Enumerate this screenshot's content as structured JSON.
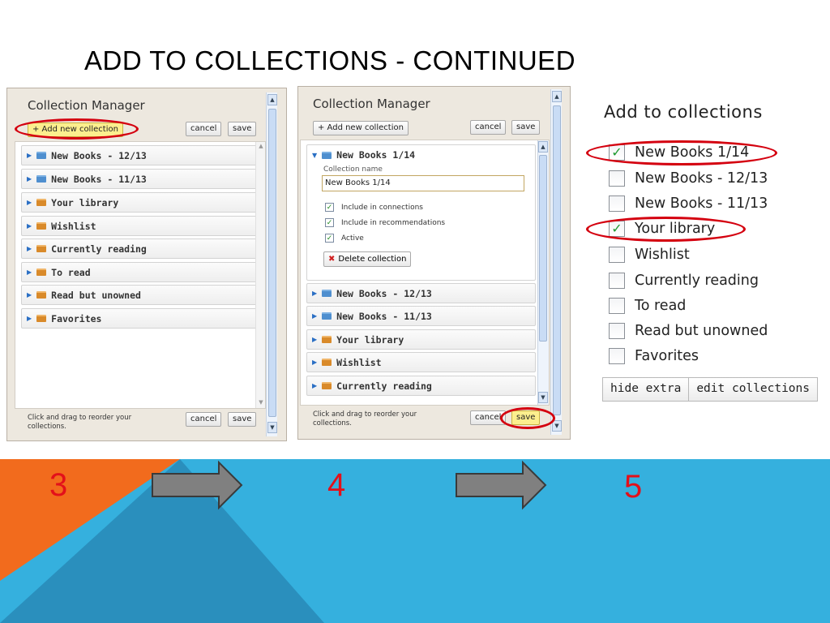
{
  "slide": {
    "title": "ADD TO COLLECTIONS - CONTINUED"
  },
  "panel3": {
    "title": "Collection Manager",
    "add_button": "+ Add new collection",
    "cancel": "cancel",
    "save": "save",
    "items": [
      {
        "label": "New Books - 12/13",
        "color": "blue"
      },
      {
        "label": "New Books - 11/13",
        "color": "blue"
      },
      {
        "label": "Your library",
        "color": "orange"
      },
      {
        "label": "Wishlist",
        "color": "orange"
      },
      {
        "label": "Currently reading",
        "color": "orange"
      },
      {
        "label": "To read",
        "color": "orange"
      },
      {
        "label": "Read but unowned",
        "color": "orange"
      },
      {
        "label": "Favorites",
        "color": "orange"
      }
    ],
    "footer_line1": "Click and drag to reorder your",
    "footer_line2": "collections.",
    "footer_cancel": "cancel",
    "footer_save": "save"
  },
  "panel4": {
    "title": "Collection Manager",
    "add_button": "+ Add new collection",
    "cancel": "cancel",
    "save": "save",
    "expanded": {
      "label": "New Books 1/14",
      "field_label": "Collection name",
      "field_value": "New Books 1/14",
      "options": [
        {
          "label": "Include in connections",
          "checked": true
        },
        {
          "label": "Include in recommendations",
          "checked": true
        },
        {
          "label": "Active",
          "checked": true
        }
      ],
      "delete_button": "Delete collection"
    },
    "items": [
      {
        "label": "New Books - 12/13",
        "color": "blue"
      },
      {
        "label": "New Books - 11/13",
        "color": "blue"
      },
      {
        "label": "Your library",
        "color": "orange"
      },
      {
        "label": "Wishlist",
        "color": "orange"
      },
      {
        "label": "Currently reading",
        "color": "orange"
      }
    ],
    "footer_line1": "Click and drag to reorder your",
    "footer_line2": "collections.",
    "footer_cancel": "cancel",
    "footer_save": "save"
  },
  "add_to_collections": {
    "title": "Add to collections",
    "items": [
      {
        "label": "New Books 1/14",
        "checked": true
      },
      {
        "label": "New Books - 12/13",
        "checked": false
      },
      {
        "label": "New Books - 11/13",
        "checked": false
      },
      {
        "label": "Your library",
        "checked": true
      },
      {
        "label": "Wishlist",
        "checked": false
      },
      {
        "label": "Currently reading",
        "checked": false
      },
      {
        "label": "To read",
        "checked": false
      },
      {
        "label": "Read but unowned",
        "checked": false
      },
      {
        "label": "Favorites",
        "checked": false
      }
    ],
    "hide_extra": "hide extra",
    "edit_collections": "edit collections"
  },
  "steps": {
    "s3": "3",
    "s4": "4",
    "s5": "5"
  },
  "colors": {
    "orange": "#f26b1d",
    "blue": "#35b0de",
    "highlight_red": "#d4000f",
    "arrow": "#808080",
    "step_number": "#e3101a"
  }
}
